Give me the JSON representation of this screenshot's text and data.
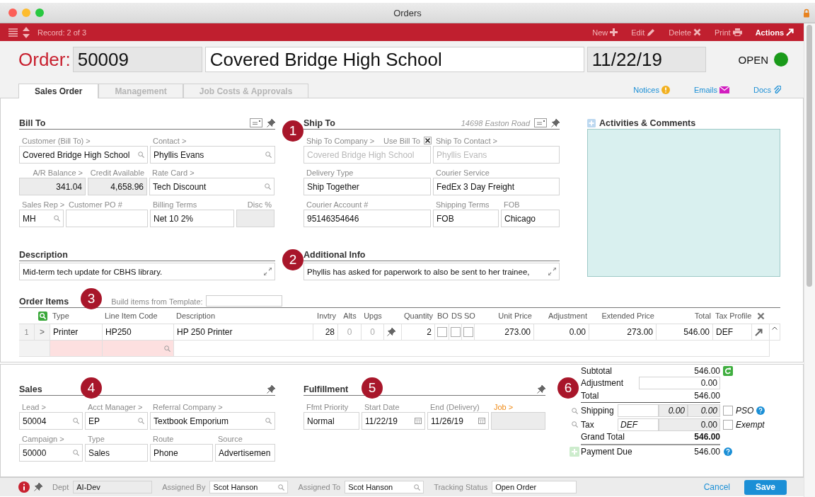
{
  "window": {
    "title": "Orders"
  },
  "toolbar": {
    "record": "Record: 2 of 3",
    "actions": [
      {
        "label": "New",
        "kind": "new"
      },
      {
        "label": "Edit",
        "kind": "edit"
      },
      {
        "label": "Delete",
        "kind": "delete"
      },
      {
        "label": "Print",
        "kind": "print"
      },
      {
        "label": "Actions",
        "kind": "actions"
      }
    ]
  },
  "header": {
    "label": "Order:",
    "number": "50009",
    "customer": "Covered Bridge High School",
    "date": "11/22/19",
    "status": "OPEN"
  },
  "tabs": [
    {
      "label": "Sales Order",
      "selected": true
    },
    {
      "label": "Management",
      "selected": false
    },
    {
      "label": "Job Costs & Approvals",
      "selected": false
    }
  ],
  "links": [
    {
      "label": "Notices",
      "kind": "notice"
    },
    {
      "label": "Emails",
      "kind": "email"
    },
    {
      "label": "Docs",
      "kind": "docs"
    }
  ],
  "bill_to": {
    "title": "Bill To",
    "fields": [
      {
        "label": "Customer (Bill To) >",
        "value": "Covered Bridge High School",
        "kind": "lookup"
      },
      {
        "label": "Contact >",
        "value": "Phyllis Evans",
        "kind": "lookup"
      },
      {
        "label": "A/R Balance >",
        "value": "341.04",
        "kind": "number"
      },
      {
        "label": "Credit Available",
        "value": "4,658.96",
        "kind": "number"
      },
      {
        "label": "Rate Card >",
        "value": "Tech Discount",
        "kind": "lookup"
      },
      {
        "label": "Sales Rep >",
        "value": "MH",
        "kind": "lookup"
      },
      {
        "label": "Customer PO #",
        "kind": "text"
      },
      {
        "label": "Billing Terms",
        "value": "Net 10 2%",
        "kind": "text"
      },
      {
        "label": "Disc %",
        "kind": "number"
      }
    ]
  },
  "ship_to": {
    "title": "Ship To",
    "address": "14698 Easton Road",
    "fields": [
      {
        "label": "Ship To Company >",
        "value": "Covered Bridge High School",
        "kind": "dim",
        "check": {
          "label": "Use Bill To",
          "checked": true
        }
      },
      {
        "label": "Ship To Contact >",
        "value": "Phyllis Evans",
        "kind": "dim"
      },
      {
        "label": "Delivery Type",
        "value": "Ship Together",
        "kind": "text"
      },
      {
        "label": "Courier Service",
        "value": "FedEx 3 Day Freight",
        "kind": "text"
      },
      {
        "label": "Courier Account #",
        "value": "95146354646",
        "kind": "text"
      },
      {
        "label": "Shipping Terms",
        "value": "FOB",
        "kind": "text"
      },
      {
        "label": "FOB",
        "value": "Chicago",
        "kind": "text"
      }
    ]
  },
  "description": {
    "title": "Description",
    "value": "Mid-term tech update for CBHS library."
  },
  "additional_info": {
    "title": "Additional Info",
    "value": "Phyllis has asked for paperwork to also be sent to her trainee,"
  },
  "activities": {
    "title": "Activities & Comments"
  },
  "order_items": {
    "title": "Order Items",
    "template_label": "Build items from Template:",
    "columns": [
      "Type",
      "Line Item Code",
      "Description",
      "Invtry",
      "Alts",
      "Upgs",
      "Quantity",
      "BO",
      "DS",
      "SO",
      "Unit Price",
      "Adjustment",
      "Extended Price",
      "Total",
      "Tax Profile"
    ],
    "rows": [
      {
        "index": "1",
        "expander": ">",
        "type": "Printer",
        "code": "HP250",
        "description": "HP 250 Printer",
        "invtry": "28",
        "alts": "0",
        "upgs": "0",
        "quantity": "2",
        "bo": false,
        "ds": false,
        "so": false,
        "unit_price": "273.00",
        "adjustment": "0.00",
        "extended_price": "273.00",
        "total": "546.00",
        "tax_profile": "DEF"
      }
    ]
  },
  "sales": {
    "title": "Sales",
    "fields": [
      {
        "label": "Lead >",
        "value": "50004",
        "kind": "lookup"
      },
      {
        "label": "Acct Manager >",
        "value": "EP",
        "kind": "lookup"
      },
      {
        "label": "Referral Company >",
        "value": "Textbook Emporium",
        "kind": "lookup"
      },
      {
        "label": "Campaign >",
        "value": "50000",
        "kind": "lookup"
      },
      {
        "label": "Type",
        "value": "Sales",
        "kind": "text"
      },
      {
        "label": "Route",
        "value": "Phone",
        "kind": "text"
      },
      {
        "label": "Source",
        "value": "Advertisemen",
        "kind": "text"
      }
    ]
  },
  "fulfillment": {
    "title": "Fulfillment",
    "fields": [
      {
        "label": "Ffmt Priority",
        "value": "Normal",
        "kind": "text"
      },
      {
        "label": "Start Date",
        "value": "11/22/19",
        "kind": "date"
      },
      {
        "label": "End (Delivery)",
        "value": "11/26/19",
        "kind": "date"
      },
      {
        "label": "Job >",
        "kind": "job"
      }
    ]
  },
  "totals": {
    "subtotal": {
      "label": "Subtotal",
      "value": "546.00"
    },
    "adjustment": {
      "label": "Adjustment",
      "value": "0.00"
    },
    "total": {
      "label": "Total",
      "value": "546.00"
    },
    "shipping": {
      "label": "Shipping",
      "cost": "0.00",
      "charge": "0.00",
      "option": "PSO",
      "checked": false
    },
    "tax": {
      "label": "Tax",
      "code": "DEF",
      "value": "0.00",
      "option": "Exempt",
      "checked": false
    },
    "grand_total": {
      "label": "Grand Total",
      "value": "546.00"
    },
    "payment_due": {
      "label": "Payment Due",
      "value": "546.00"
    }
  },
  "footer": {
    "fields": [
      {
        "label": "Dept",
        "value": "AI-Dev",
        "kind": "readonly"
      },
      {
        "label": "Assigned By",
        "value": "Scot Hanson",
        "kind": "lookup"
      },
      {
        "label": "Assigned To",
        "value": "Scot Hanson",
        "kind": "lookup"
      },
      {
        "label": "Tracking Status",
        "value": "Open Order",
        "kind": "text"
      }
    ],
    "cancel": "Cancel",
    "save": "Save"
  },
  "callouts": [
    "1",
    "2",
    "3",
    "4",
    "5",
    "6"
  ]
}
